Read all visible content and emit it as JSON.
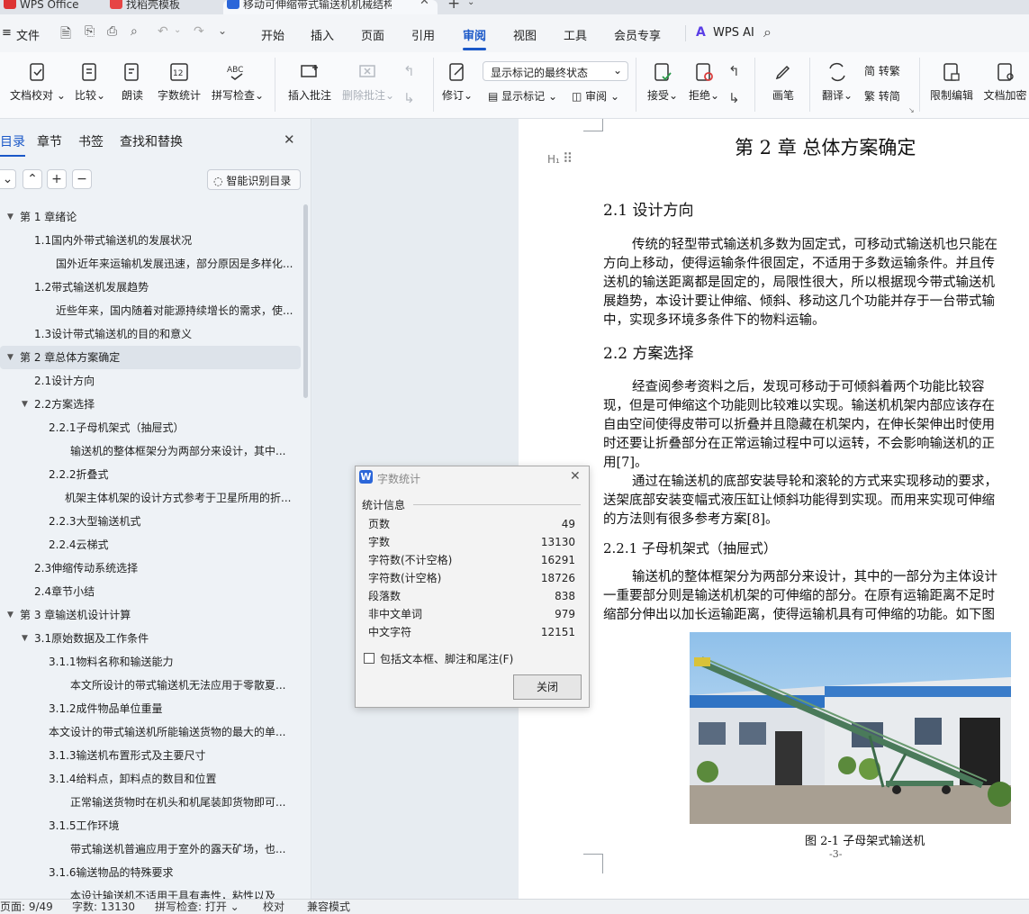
{
  "titlebar": {
    "tabs": [
      {
        "label": "WPS Office"
      },
      {
        "label": "找稻壳模板"
      },
      {
        "label": "移动可伸缩带式输送机机械结构..."
      }
    ]
  },
  "menubar": {
    "file_label": "文件",
    "items": [
      "开始",
      "插入",
      "页面",
      "引用",
      "审阅",
      "视图",
      "工具",
      "会员专享"
    ],
    "active": "审阅",
    "wps_ai": "WPS AI"
  },
  "ribbon": {
    "buttons": [
      "文档校对",
      "比较",
      "朗读",
      "字数统计",
      "拼写检查",
      "插入批注",
      "删除批注",
      "修订",
      "接受",
      "拒绝",
      "画笔",
      "翻译",
      "限制编辑",
      "文档加密"
    ],
    "markup_select": "显示标记的最终状态",
    "show_markup": "显示标记",
    "review_pane": "审阅",
    "trad_to_simp": "繁 转简",
    "simp_to_trad": "简 转繁"
  },
  "nav": {
    "tabs": [
      "目录",
      "章节",
      "书签",
      "查找和替换"
    ],
    "smart_toc": "智能识别目录",
    "toc": [
      {
        "text": "第 1 章绪论",
        "level": 0,
        "tri": "down"
      },
      {
        "text": "1.1国内外带式输送机的发展状况",
        "level": 1
      },
      {
        "text": "国外近年来运输机发展迅速，部分原因是多样化...",
        "level": 3
      },
      {
        "text": "1.2带式输送机发展趋势",
        "level": 1
      },
      {
        "text": "近些年来，国内随着对能源持续增长的需求，使...",
        "level": 3
      },
      {
        "text": "1.3设计带式输送机的目的和意义",
        "level": 1
      },
      {
        "text": "第 2 章总体方案确定",
        "level": 0,
        "tri": "down",
        "selected": true
      },
      {
        "text": "2.1设计方向",
        "level": 1
      },
      {
        "text": "2.2方案选择",
        "level": 1,
        "tri": "down"
      },
      {
        "text": "2.2.1子母机架式（抽屉式）",
        "level": 2
      },
      {
        "text": "输送机的整体框架分为两部分来设计，其中...",
        "level": 4
      },
      {
        "text": "2.2.2折叠式",
        "level": 2
      },
      {
        "text": "机架主体机架的设计方式参考于卫星所用的折...",
        "level": 5
      },
      {
        "text": "2.2.3大型输送机式",
        "level": 2
      },
      {
        "text": "2.2.4云梯式",
        "level": 2
      },
      {
        "text": "2.3伸缩传动系统选择",
        "level": 1
      },
      {
        "text": "2.4章节小结",
        "level": 1
      },
      {
        "text": "第 3 章输送机设计计算",
        "level": 0,
        "tri": "down"
      },
      {
        "text": "3.1原始数据及工作条件",
        "level": 1,
        "tri": "down"
      },
      {
        "text": "3.1.1物料名称和输送能力",
        "level": 2
      },
      {
        "text": "本文所设计的带式输送机无法应用于零散夏...",
        "level": 4
      },
      {
        "text": "3.1.2成件物品单位重量",
        "level": 2
      },
      {
        "text": "本文设计的带式输送机所能输送货物的最大的单...",
        "level": 6
      },
      {
        "text": "3.1.3输送机布置形式及主要尺寸",
        "level": 2
      },
      {
        "text": "3.1.4给料点，卸料点的数目和位置",
        "level": 2
      },
      {
        "text": "正常输送货物时在机头和机尾装卸货物即可...",
        "level": 4
      },
      {
        "text": "3.1.5工作环境",
        "level": 2
      },
      {
        "text": "带式输送机普遍应用于室外的露天矿场，也...",
        "level": 4
      },
      {
        "text": "3.1.6输送物品的特殊要求",
        "level": 2
      },
      {
        "text": "本设计输送机不适用于具有毒性，粘性以及",
        "level": 4
      }
    ]
  },
  "document": {
    "heading_marker": "H₁",
    "chapter_title": "第 2 章  总体方案确定",
    "s21_title": "2.1  设计方向",
    "s21_para": [
      "传统的轻型带式输送机多数为固定式，可移动式输送机也只能在",
      "方向上移动，使得运输条件很固定，不适用于多数运输条件。并且传",
      "送机的输送距离都是固定的，局限性很大，所以根据现今带式输送机",
      "展趋势，本设计要让伸缩、倾斜、移动这几个功能并存于一台带式输",
      "中，实现多环境多条件下的物料运输。"
    ],
    "s22_title": "2.2  方案选择",
    "s22_para": [
      "经查阅参考资料之后，发现可移动于可倾斜着两个功能比较容",
      "现，但是可伸缩这个功能则比较难以实现。输送机机架内部应该存在",
      "自由空间使得皮带可以折叠并且隐藏在机架内，在伸长架伸出时使用",
      "时还要让折叠部分在正常运输过程中可以运转，不会影响输送机的正",
      "用[7]。",
      "通过在输送机的底部安装导轮和滚轮的方式来实现移动的要求，",
      "送架底部安装变幅式液压缸让倾斜功能得到实现。而用来实现可伸缩",
      "的方法则有很多参考方案[8]。"
    ],
    "s221_title": "2.2.1  子母机架式（抽屉式）",
    "s221_para": [
      "输送机的整体框架分为两部分来设计，其中的一部分为主体设计",
      "一重要部分则是输送机机架的可伸缩的部分。在原有运输距离不足时",
      "缩部分伸出以加长运输距离，使得运输机具有可伸缩的功能。如下图"
    ],
    "figure_caption": "图 2-1  子母架式输送机",
    "page_number": "-3-"
  },
  "dialog": {
    "title": "字数统计",
    "section": "统计信息",
    "rows": [
      {
        "label": "页数",
        "value": "49"
      },
      {
        "label": "字数",
        "value": "13130"
      },
      {
        "label": "字符数(不计空格)",
        "value": "16291"
      },
      {
        "label": "字符数(计空格)",
        "value": "18726"
      },
      {
        "label": "段落数",
        "value": "838"
      },
      {
        "label": "非中文单词",
        "value": "979"
      },
      {
        "label": "中文字符",
        "value": "12151"
      }
    ],
    "checkbox_label": "包括文本框、脚注和尾注(F)",
    "close_label": "关闭"
  },
  "statusbar": {
    "page": "页面: 9/49",
    "words": "字数: 13130",
    "spell": "拼写检查: 打开",
    "proof": "校对",
    "compat": "兼容模式"
  },
  "colors": {
    "accent": "#1a58c8",
    "wps_blue": "#2b66d9",
    "retry_red": "#d93a3a"
  }
}
